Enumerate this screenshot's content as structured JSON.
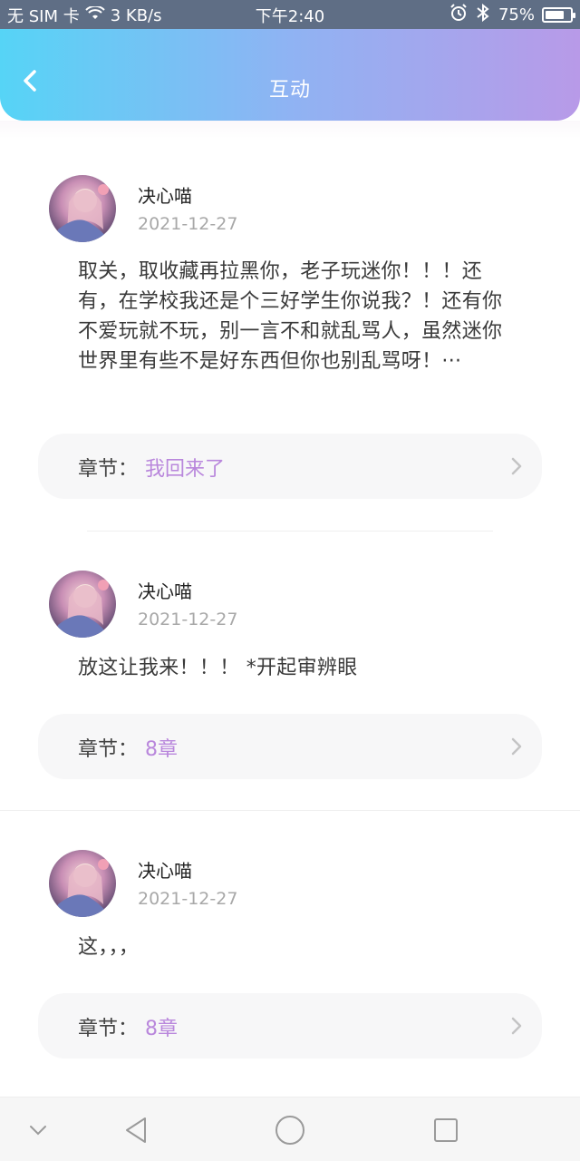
{
  "status_bar": {
    "carrier": "无 SIM 卡",
    "speed": "3 KB/s",
    "time": "下午2:40",
    "battery": "75%",
    "battery_level": 0.75,
    "icons": [
      "wifi-icon",
      "alarm-icon",
      "bluetooth-icon",
      "battery-icon"
    ]
  },
  "header": {
    "title": "互动",
    "back_icon": "chevron-left-icon"
  },
  "posts": [
    {
      "username": "决心喵",
      "date": "2021-12-27",
      "content": "取关，取收藏再拉黑你，老子玩迷你！！！还有，在学校我还是个三好学生你说我？！还有你不爱玩就不玩，别一言不和就乱骂人，虽然迷你世界里有些不是好东西但你也别乱骂呀！···",
      "chapter_label": "章节：",
      "chapter_value": "我回来了"
    },
    {
      "username": "决心喵",
      "date": "2021-12-27",
      "content": "放这让我来！！！ *开起审辨眼",
      "chapter_label": "章节：",
      "chapter_value": "8章"
    },
    {
      "username": "决心喵",
      "date": "2021-12-27",
      "content": "这，，，",
      "chapter_label": "章节：",
      "chapter_value": "8章"
    }
  ],
  "nav_bar": {
    "icons": [
      "collapse-icon",
      "back-triangle-icon",
      "home-circle-icon",
      "recents-square-icon"
    ]
  },
  "colors": {
    "header_gradient_start": "#56d4f6",
    "header_gradient_end": "#b89ae8",
    "chapter_accent": "#b987dc"
  }
}
